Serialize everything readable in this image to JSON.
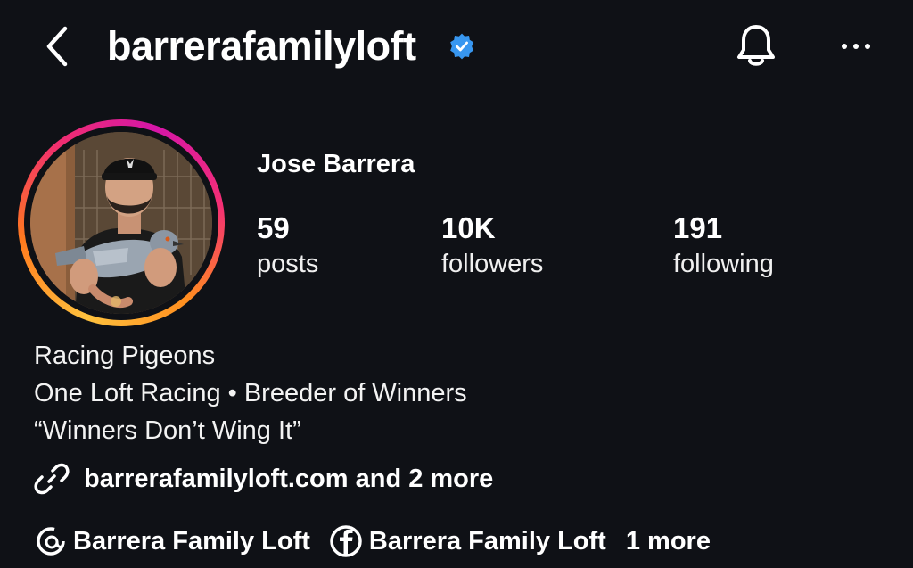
{
  "header": {
    "username": "barrerafamilyloft",
    "verified": true,
    "icons": [
      "back-chevron-icon",
      "verified-badge-icon",
      "bell-icon",
      "more-dots-icon"
    ]
  },
  "profile": {
    "display_name": "Jose Barrera",
    "avatar_ring_colors": [
      "#ffc23e",
      "#ff7a1e",
      "#f12f6e",
      "#d616a8"
    ]
  },
  "stats": [
    {
      "value": "59",
      "label": "posts"
    },
    {
      "value": "10K",
      "label": "followers"
    },
    {
      "value": "191",
      "label": "following"
    }
  ],
  "bio": {
    "lines": [
      "Racing Pigeons",
      "One Loft Racing • Breeder of Winners",
      "“Winners Don’t Wing It”"
    ]
  },
  "links": {
    "text": "barrerafamilyloft.com and 2 more",
    "icon": "link-icon"
  },
  "social": {
    "threads_label": "Barrera Family Loft",
    "facebook_label": "Barrera Family Loft",
    "more_label": "1 more"
  },
  "colors": {
    "background": "#0f1116",
    "text": "#ffffff",
    "verified_blue": "#3897f0"
  }
}
